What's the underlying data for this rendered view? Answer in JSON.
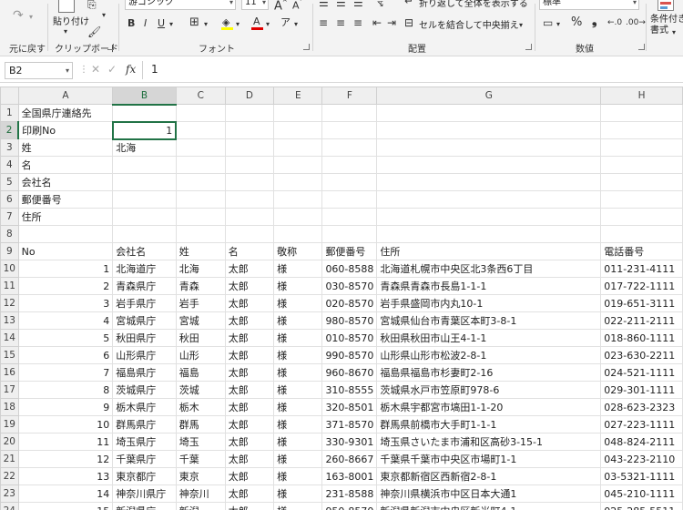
{
  "ribbon": {
    "undo_group_label": "元に戻す",
    "clipboard": {
      "paste_label": "貼り付け",
      "group_label": "クリップボード"
    },
    "font": {
      "font_name": "游ゴシック",
      "font_size": "11",
      "group_label": "フォント"
    },
    "alignment": {
      "wrap_text": "折り返して全体を表示する",
      "merge_center": "セルを結合して中央揃え",
      "group_label": "配置"
    },
    "number": {
      "format": "標準",
      "group_label": "数値"
    },
    "styles": {
      "conditional_format": "条件付き書式"
    }
  },
  "formula_bar": {
    "name_box": "B2",
    "fx_label": "fx",
    "content": "1"
  },
  "sheet": {
    "columns": [
      "A",
      "B",
      "C",
      "D",
      "E",
      "F",
      "G",
      "H"
    ],
    "rows": [
      {
        "n": "1",
        "a": "全国県庁連絡先",
        "b": "",
        "c": "",
        "d": "",
        "e": "",
        "f": "",
        "g": "",
        "h": ""
      },
      {
        "n": "2",
        "a": "印刷No",
        "b": "1",
        "c": "",
        "d": "",
        "e": "",
        "f": "",
        "g": "",
        "h": ""
      },
      {
        "n": "3",
        "a": "姓",
        "b": "北海",
        "c": "",
        "d": "",
        "e": "",
        "f": "",
        "g": "",
        "h": ""
      },
      {
        "n": "4",
        "a": "名",
        "b": "",
        "c": "",
        "d": "",
        "e": "",
        "f": "",
        "g": "",
        "h": ""
      },
      {
        "n": "5",
        "a": "会社名",
        "b": "",
        "c": "",
        "d": "",
        "e": "",
        "f": "",
        "g": "",
        "h": ""
      },
      {
        "n": "6",
        "a": "郵便番号",
        "b": "",
        "c": "",
        "d": "",
        "e": "",
        "f": "",
        "g": "",
        "h": ""
      },
      {
        "n": "7",
        "a": "住所",
        "b": "",
        "c": "",
        "d": "",
        "e": "",
        "f": "",
        "g": "",
        "h": ""
      },
      {
        "n": "8",
        "a": "",
        "b": "",
        "c": "",
        "d": "",
        "e": "",
        "f": "",
        "g": "",
        "h": ""
      },
      {
        "n": "9",
        "a": "No",
        "b": "会社名",
        "c": "姓",
        "d": "名",
        "e": "敬称",
        "f": "郵便番号",
        "g": "住所",
        "h": "電話番号"
      },
      {
        "n": "10",
        "a": "1",
        "b": "北海道庁",
        "c": "北海",
        "d": "太郎",
        "e": "様",
        "f": "060-8588",
        "g": "北海道札幌市中央区北3条西6丁目",
        "h": "011-231-4111"
      },
      {
        "n": "11",
        "a": "2",
        "b": "青森県庁",
        "c": "青森",
        "d": "太郎",
        "e": "様",
        "f": "030-8570",
        "g": "青森県青森市長島1-1-1",
        "h": "017-722-1111"
      },
      {
        "n": "12",
        "a": "3",
        "b": "岩手県庁",
        "c": "岩手",
        "d": "太郎",
        "e": "様",
        "f": "020-8570",
        "g": "岩手県盛岡市内丸10-1",
        "h": "019-651-3111"
      },
      {
        "n": "13",
        "a": "4",
        "b": "宮城県庁",
        "c": "宮城",
        "d": "太郎",
        "e": "様",
        "f": "980-8570",
        "g": "宮城県仙台市青葉区本町3-8-1",
        "h": "022-211-2111"
      },
      {
        "n": "14",
        "a": "5",
        "b": "秋田県庁",
        "c": "秋田",
        "d": "太郎",
        "e": "様",
        "f": "010-8570",
        "g": "秋田県秋田市山王4-1-1",
        "h": "018-860-1111"
      },
      {
        "n": "15",
        "a": "6",
        "b": "山形県庁",
        "c": "山形",
        "d": "太郎",
        "e": "様",
        "f": "990-8570",
        "g": "山形県山形市松波2-8-1",
        "h": "023-630-2211"
      },
      {
        "n": "16",
        "a": "7",
        "b": "福島県庁",
        "c": "福島",
        "d": "太郎",
        "e": "様",
        "f": "960-8670",
        "g": "福島県福島市杉妻町2-16",
        "h": "024-521-1111"
      },
      {
        "n": "17",
        "a": "8",
        "b": "茨城県庁",
        "c": "茨城",
        "d": "太郎",
        "e": "様",
        "f": "310-8555",
        "g": "茨城県水戸市笠原町978-6",
        "h": "029-301-1111"
      },
      {
        "n": "18",
        "a": "9",
        "b": "栃木県庁",
        "c": "栃木",
        "d": "太郎",
        "e": "様",
        "f": "320-8501",
        "g": "栃木県宇都宮市塙田1-1-20",
        "h": "028-623-2323"
      },
      {
        "n": "19",
        "a": "10",
        "b": "群馬県庁",
        "c": "群馬",
        "d": "太郎",
        "e": "様",
        "f": "371-8570",
        "g": "群馬県前橋市大手町1-1-1",
        "h": "027-223-1111"
      },
      {
        "n": "20",
        "a": "11",
        "b": "埼玉県庁",
        "c": "埼玉",
        "d": "太郎",
        "e": "様",
        "f": "330-9301",
        "g": "埼玉県さいたま市浦和区高砂3-15-1",
        "h": "048-824-2111"
      },
      {
        "n": "21",
        "a": "12",
        "b": "千葉県庁",
        "c": "千葉",
        "d": "太郎",
        "e": "様",
        "f": "260-8667",
        "g": "千葉県千葉市中央区市場町1-1",
        "h": "043-223-2110"
      },
      {
        "n": "22",
        "a": "13",
        "b": "東京都庁",
        "c": "東京",
        "d": "太郎",
        "e": "様",
        "f": "163-8001",
        "g": "東京都新宿区西新宿2-8-1",
        "h": "03-5321-1111"
      },
      {
        "n": "23",
        "a": "14",
        "b": "神奈川県庁",
        "c": "神奈川",
        "d": "太郎",
        "e": "様",
        "f": "231-8588",
        "g": "神奈川県横浜市中区日本大通1",
        "h": "045-210-1111"
      },
      {
        "n": "24",
        "a": "15",
        "b": "新潟県庁",
        "c": "新潟",
        "d": "太郎",
        "e": "様",
        "f": "950-8570",
        "g": "新潟県新潟市中央区新光町4-1",
        "h": "025-285-5511"
      }
    ]
  }
}
